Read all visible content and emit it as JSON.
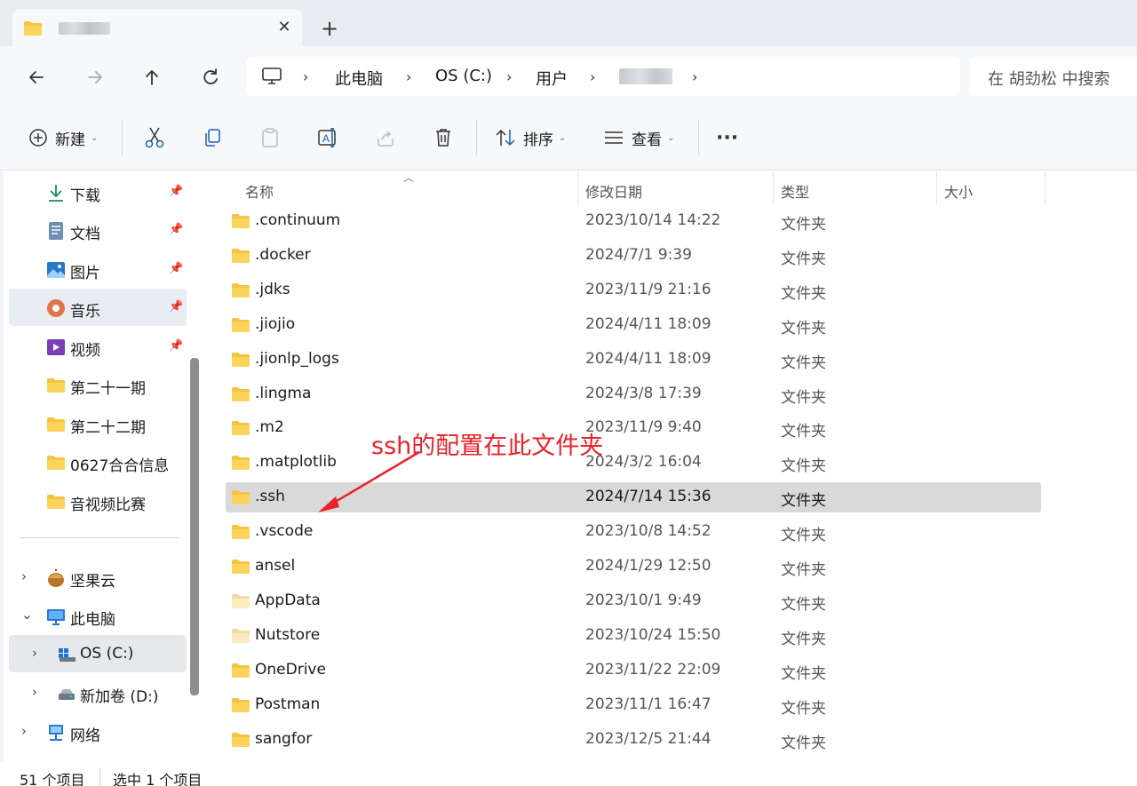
{
  "window": {
    "tab_icon": "folder-icon",
    "close_icon": "close-icon",
    "new_tab_icon": "plus-icon"
  },
  "nav": {
    "back_icon": "arrow-left-icon",
    "forward_icon": "arrow-right-icon",
    "up_icon": "arrow-up-icon",
    "refresh_icon": "refresh-icon",
    "breadcrumb": [
      "此电脑",
      "OS (C:)",
      "用户"
    ],
    "search_placeholder": "在 胡劲松 中搜索"
  },
  "toolbar": {
    "new_label": "新建",
    "sort_label": "排序",
    "view_label": "查看",
    "more_label": "···"
  },
  "sidebar": {
    "quick_access": [
      {
        "label": "下载",
        "icon": "download-icon",
        "pinned": true
      },
      {
        "label": "文档",
        "icon": "document-icon",
        "pinned": true
      },
      {
        "label": "图片",
        "icon": "picture-icon",
        "pinned": true
      },
      {
        "label": "音乐",
        "icon": "music-icon",
        "pinned": true
      },
      {
        "label": "视频",
        "icon": "video-icon",
        "pinned": true
      },
      {
        "label": "第二十一期",
        "icon": "folder-icon"
      },
      {
        "label": "第二十二期",
        "icon": "folder-icon"
      },
      {
        "label": "0627合合信息",
        "icon": "folder-icon"
      },
      {
        "label": "音视频比赛",
        "icon": "folder-icon"
      }
    ],
    "tree": [
      {
        "label": "坚果云",
        "icon": "nutstore-icon"
      },
      {
        "label": "此电脑",
        "icon": "pc-icon"
      },
      {
        "label": "OS (C:)",
        "icon": "drive-icon"
      },
      {
        "label": "新加卷 (D:)",
        "icon": "drive-icon"
      },
      {
        "label": "网络",
        "icon": "network-icon"
      }
    ]
  },
  "columns": {
    "name": "名称",
    "date": "修改日期",
    "type": "类型",
    "size": "大小"
  },
  "files": [
    {
      "name": ".continuum",
      "date": "2023/10/14 14:22",
      "type": "文件夹"
    },
    {
      "name": ".docker",
      "date": "2024/7/1 9:39",
      "type": "文件夹"
    },
    {
      "name": ".jdks",
      "date": "2023/11/9 21:16",
      "type": "文件夹"
    },
    {
      "name": ".jiojio",
      "date": "2024/4/11 18:09",
      "type": "文件夹"
    },
    {
      "name": ".jionlp_logs",
      "date": "2024/4/11 18:09",
      "type": "文件夹"
    },
    {
      "name": ".lingma",
      "date": "2024/3/8 17:39",
      "type": "文件夹"
    },
    {
      "name": ".m2",
      "date": "2023/11/9 9:40",
      "type": "文件夹"
    },
    {
      "name": ".matplotlib",
      "date": "2024/3/2 16:04",
      "type": "文件夹"
    },
    {
      "name": ".ssh",
      "date": "2024/7/14 15:36",
      "type": "文件夹",
      "selected": true
    },
    {
      "name": ".vscode",
      "date": "2023/10/8 14:52",
      "type": "文件夹"
    },
    {
      "name": "ansel",
      "date": "2024/1/29 12:50",
      "type": "文件夹"
    },
    {
      "name": "AppData",
      "date": "2023/10/1 9:49",
      "type": "文件夹"
    },
    {
      "name": "Nutstore",
      "date": "2023/10/24 15:50",
      "type": "文件夹"
    },
    {
      "name": "OneDrive",
      "date": "2023/11/22 22:09",
      "type": "文件夹"
    },
    {
      "name": "Postman",
      "date": "2023/11/1 16:47",
      "type": "文件夹"
    },
    {
      "name": "sangfor",
      "date": "2023/12/5 21:44",
      "type": "文件夹"
    }
  ],
  "annotation": {
    "text": "ssh的配置在此文件夹",
    "color": "#e8212a"
  },
  "status": {
    "item_count": "51 个项目",
    "selected": "选中 1 个项目"
  }
}
